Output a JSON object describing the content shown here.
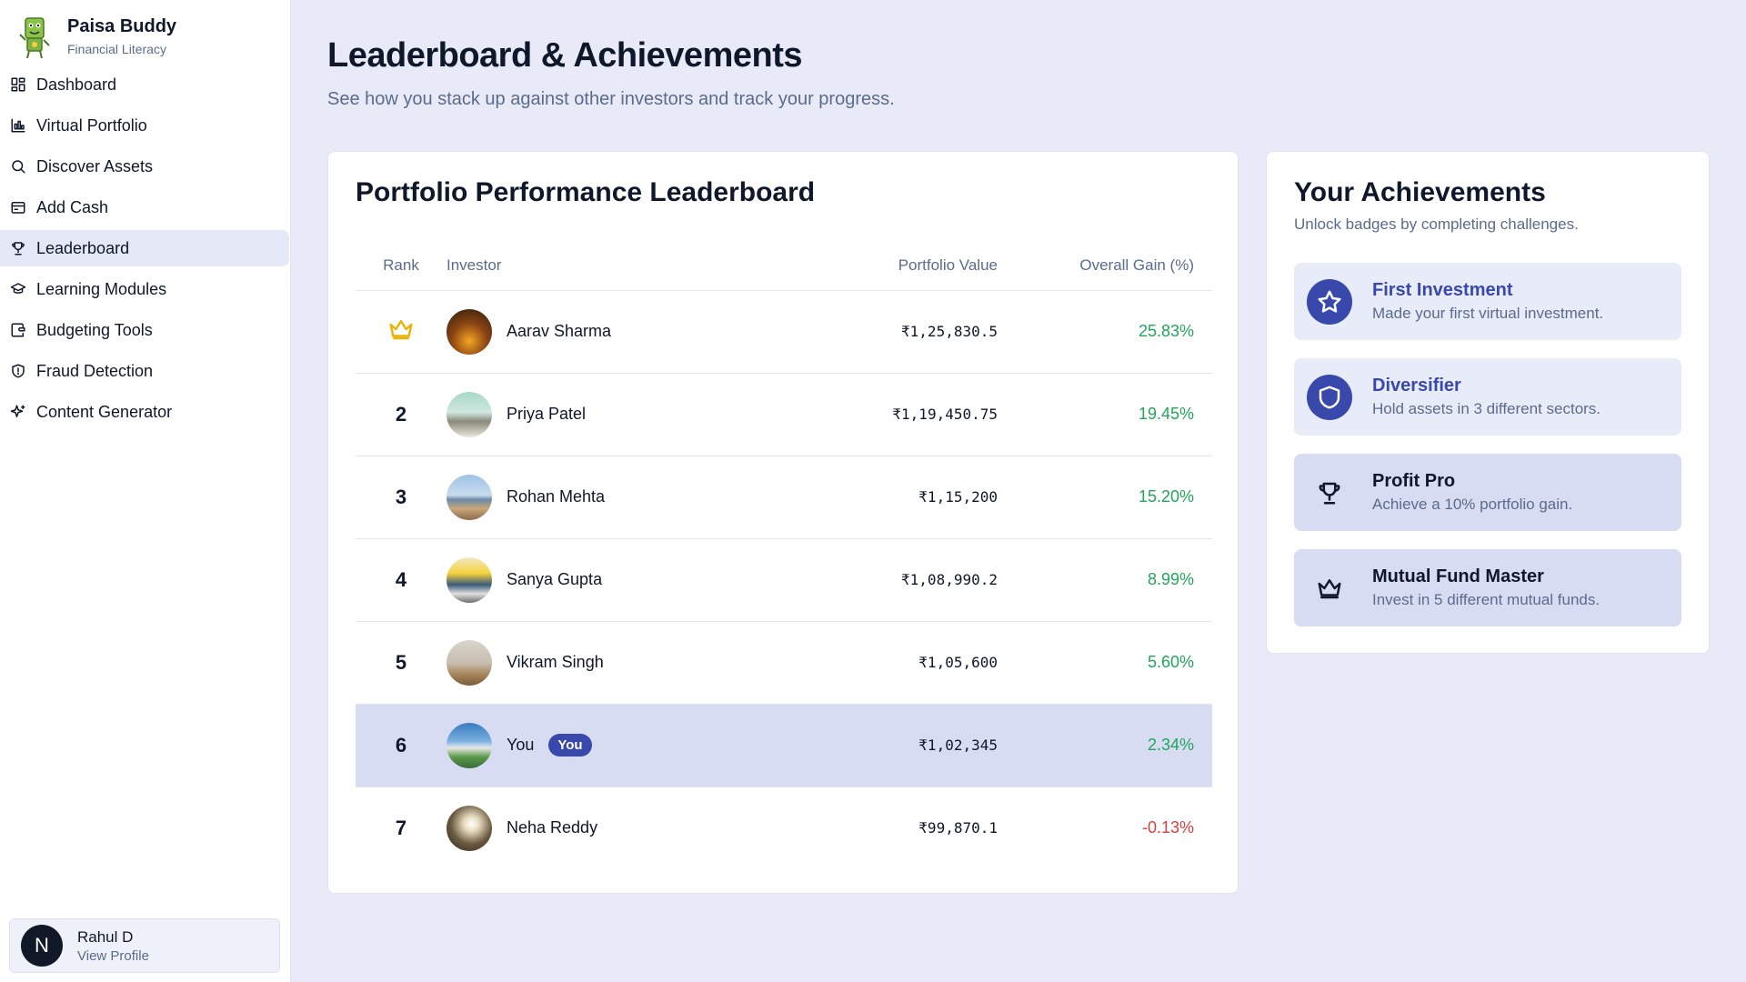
{
  "brand": {
    "name": "Paisa Buddy",
    "tagline": "Financial Literacy"
  },
  "nav": {
    "items": [
      {
        "label": "Dashboard",
        "icon": "dashboard-icon"
      },
      {
        "label": "Virtual Portfolio",
        "icon": "chart-icon"
      },
      {
        "label": "Discover Assets",
        "icon": "search-icon"
      },
      {
        "label": "Add Cash",
        "icon": "wallet-icon"
      },
      {
        "label": "Leaderboard",
        "icon": "trophy-icon",
        "active": true
      },
      {
        "label": "Learning Modules",
        "icon": "graduation-cap-icon"
      },
      {
        "label": "Budgeting Tools",
        "icon": "budget-wallet-icon"
      },
      {
        "label": "Fraud Detection",
        "icon": "shield-icon"
      },
      {
        "label": "Content Generator",
        "icon": "sparkles-icon"
      }
    ]
  },
  "profile": {
    "initial": "N",
    "name": "Rahul D",
    "link": "View Profile"
  },
  "page": {
    "title": "Leaderboard & Achievements",
    "subtitle": "See how you stack up against other investors and track your progress."
  },
  "leaderboard": {
    "title": "Portfolio Performance Leaderboard",
    "columns": {
      "rank": "Rank",
      "investor": "Investor",
      "value": "Portfolio Value",
      "gain": "Overall Gain (%)"
    },
    "rows": [
      {
        "rank": "1",
        "name": "Aarav Sharma",
        "value": "₹1,25,830.5",
        "gain": "25.83%"
      },
      {
        "rank": "2",
        "name": "Priya Patel",
        "value": "₹1,19,450.75",
        "gain": "19.45%"
      },
      {
        "rank": "3",
        "name": "Rohan Mehta",
        "value": "₹1,15,200",
        "gain": "15.20%"
      },
      {
        "rank": "4",
        "name": "Sanya Gupta",
        "value": "₹1,08,990.2",
        "gain": "8.99%"
      },
      {
        "rank": "5",
        "name": "Vikram Singh",
        "value": "₹1,05,600",
        "gain": "5.60%"
      },
      {
        "rank": "6",
        "name": "You",
        "badge": "You",
        "value": "₹1,02,345",
        "gain": "2.34%"
      },
      {
        "rank": "7",
        "name": "Neha Reddy",
        "value": "₹99,870.1",
        "gain": "-0.13%"
      }
    ]
  },
  "achievements": {
    "title": "Your Achievements",
    "subtitle": "Unlock badges by completing challenges.",
    "items": [
      {
        "name": "First Investment",
        "desc": "Made your first virtual investment.",
        "icon": "star-icon",
        "unlocked": true
      },
      {
        "name": "Diversifier",
        "desc": "Hold assets in 3 different sectors.",
        "icon": "shield-icon",
        "unlocked": true
      },
      {
        "name": "Profit Pro",
        "desc": "Achieve a 10% portfolio gain.",
        "icon": "trophy-icon",
        "unlocked": false
      },
      {
        "name": "Mutual Fund Master",
        "desc": "Invest in 5 different mutual funds.",
        "icon": "crown-icon",
        "unlocked": false
      }
    ]
  },
  "colors": {
    "accent": "#3949ab",
    "positive": "#22a55a",
    "negative": "#e23c3c",
    "gold": "#eab308"
  }
}
